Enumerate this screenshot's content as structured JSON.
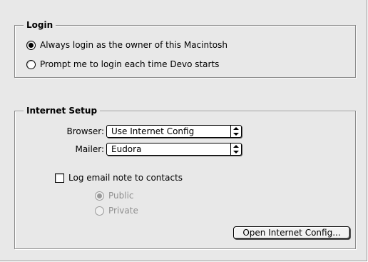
{
  "login": {
    "title": "Login",
    "options": [
      {
        "label": "Always login as the owner of this Macintosh",
        "selected": true
      },
      {
        "label": "Prompt me to login each time Devo starts",
        "selected": false
      }
    ]
  },
  "internet_setup": {
    "title": "Internet Setup",
    "browser_label": "Browser:",
    "browser_value": "Use Internet Config",
    "mailer_label": "Mailer:",
    "mailer_value": "Eudora",
    "log_email_label": "Log email note to contacts",
    "log_email_checked": false,
    "visibility_options": [
      {
        "label": "Public",
        "selected": true,
        "enabled": false
      },
      {
        "label": "Private",
        "selected": false,
        "enabled": false
      }
    ],
    "open_button": "Open Internet Config..."
  }
}
